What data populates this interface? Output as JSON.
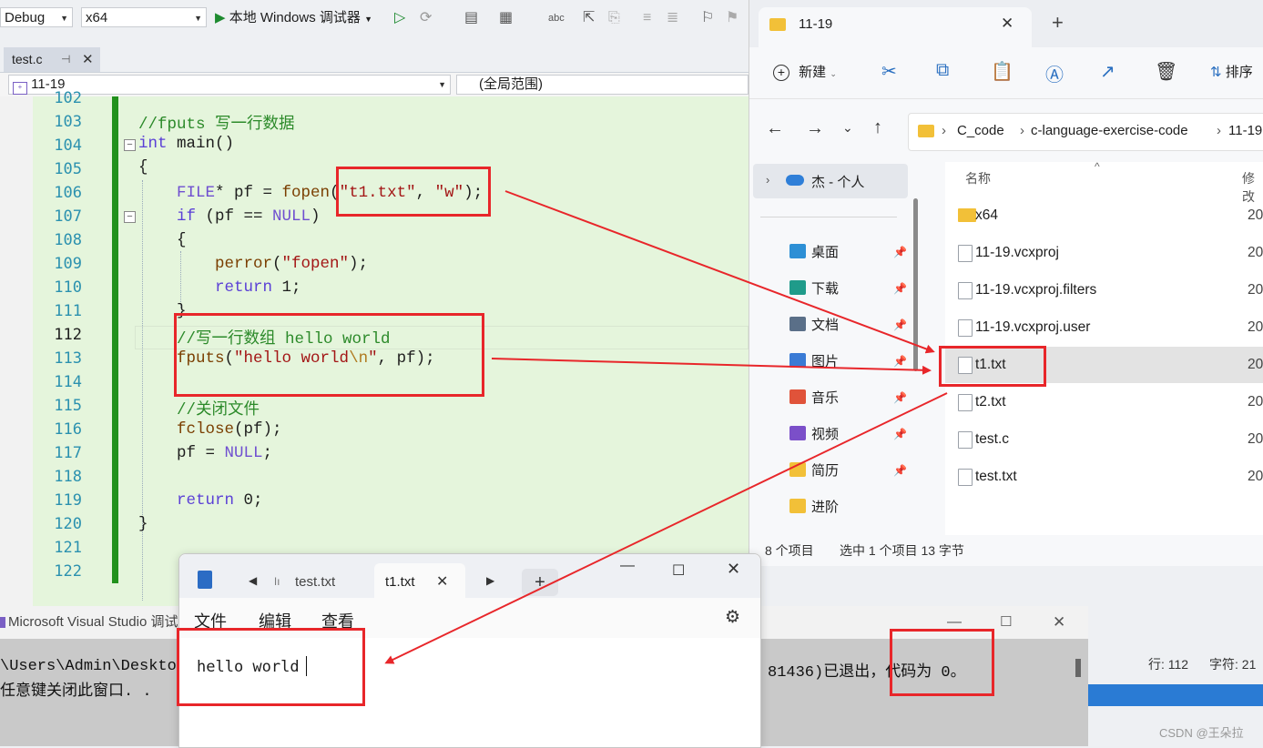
{
  "vs": {
    "config": "Debug",
    "platform": "x64",
    "debugger_label": "本地 Windows 调试器",
    "tab_label": "test.c",
    "nav_project": "11-19",
    "nav_scope": "(全局范围)",
    "line_numbers": [
      "102",
      "103",
      "104",
      "105",
      "106",
      "107",
      "108",
      "109",
      "110",
      "111",
      "112",
      "113",
      "114",
      "115",
      "116",
      "117",
      "118",
      "119",
      "120",
      "121",
      "122"
    ],
    "current_line": "112",
    "code": {
      "c103": "//fputs 写一行数据",
      "c104_kw": "int",
      "c104_rest": " main()",
      "c105": "{",
      "c106_macro": "FILE",
      "c106_a": "* pf = ",
      "c106_fn": "fopen",
      "c106_b": "(",
      "c106_s1": "\"t1.txt\"",
      "c106_c": ", ",
      "c106_s2": "\"w\"",
      "c106_d": ");",
      "c107_kw": "if",
      "c107_a": " (pf == ",
      "c107_null": "NULL",
      "c107_b": ")",
      "c108": "{",
      "c109_fn": "perror",
      "c109_a": "(",
      "c109_s": "\"fopen\"",
      "c109_b": ");",
      "c110_kw": "return",
      "c110_rest": " 1;",
      "c111": "}",
      "c112": "//写一行数组 hello world",
      "c113_fn": "fputs",
      "c113_a": "(",
      "c113_s1": "\"hello world",
      "c113_esc": "\\n",
      "c113_s2": "\"",
      "c113_b": ", pf);",
      "c115": "//关闭文件",
      "c116_fn": "fclose",
      "c116_rest": "(pf);",
      "c117_a": "pf = ",
      "c117_null": "NULL",
      "c117_b": ";",
      "c119_kw": "return",
      "c119_rest": " 0;",
      "c120": "}"
    },
    "status_line": "行: 112",
    "status_char": "字符: 21"
  },
  "explorer": {
    "tab_title": "11-19",
    "new_label": "新建",
    "sort_label": "排序",
    "breadcrumb": [
      "C_code",
      "c-language-exercise-code",
      "11-19"
    ],
    "nav_top": "杰 - 个人",
    "nav_items": [
      {
        "label": "桌面",
        "color": "#2d8fd5"
      },
      {
        "label": "下载",
        "color": "#1f9b8a"
      },
      {
        "label": "文档",
        "color": "#5a6f88"
      },
      {
        "label": "图片",
        "color": "#3a7bd5"
      },
      {
        "label": "音乐",
        "color": "#e0533a"
      },
      {
        "label": "视频",
        "color": "#7b4fc9"
      },
      {
        "label": "简历",
        "color": "#f2c038"
      },
      {
        "label": "进阶",
        "color": "#f2c038"
      }
    ],
    "column_name": "名称",
    "column_date": "修改",
    "files": [
      {
        "name": "x64",
        "date": "20",
        "icon": "folder"
      },
      {
        "name": "11-19.vcxproj",
        "date": "20",
        "icon": "file"
      },
      {
        "name": "11-19.vcxproj.filters",
        "date": "20",
        "icon": "file"
      },
      {
        "name": "11-19.vcxproj.user",
        "date": "20",
        "icon": "file"
      },
      {
        "name": "t1.txt",
        "date": "20",
        "icon": "text"
      },
      {
        "name": "t2.txt",
        "date": "20",
        "icon": "text"
      },
      {
        "name": "test.c",
        "date": "20",
        "icon": "file"
      },
      {
        "name": "test.txt",
        "date": "20",
        "icon": "text"
      }
    ],
    "status_count": "8 个项目",
    "status_selected": "选中 1 个项目  13 字节"
  },
  "console": {
    "title": "Microsoft Visual Studio 调试",
    "line1_left": "\\Users\\Admin\\Desktop",
    "line2_left": "任意键关闭此窗口. .",
    "line1_right": "81436)已退出，代码为 0。"
  },
  "notepad": {
    "tab_inactive": "test.txt",
    "tab_active": "t1.txt",
    "menu": [
      "文件",
      "编辑",
      "查看"
    ],
    "content": "hello world"
  },
  "watermark": "CSDN @王朵拉",
  "colors": {
    "annotation_red": "#e8262a",
    "change_bar": "#21911c",
    "editor_bg": "#e5f5dc"
  }
}
